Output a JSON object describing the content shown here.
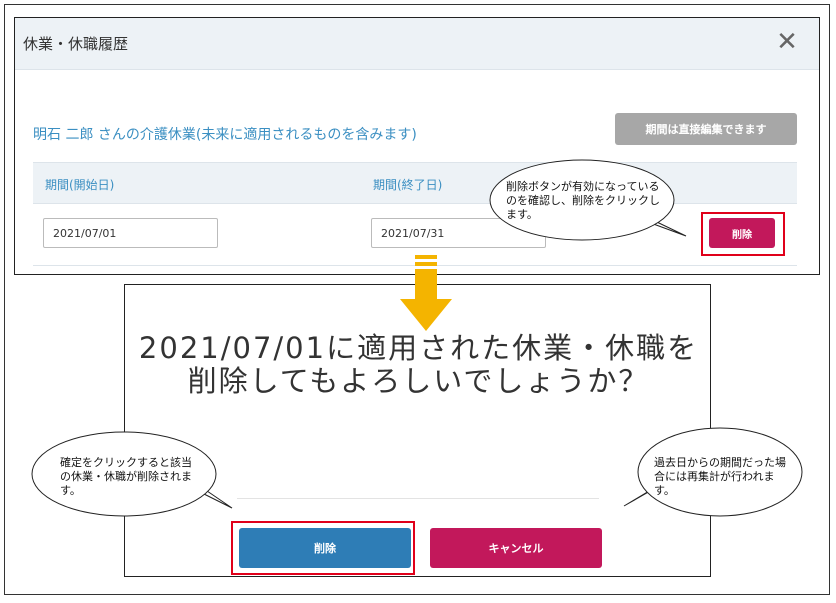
{
  "top_modal": {
    "title": "休業・休職履歴",
    "close_symbol": "✕",
    "employee_heading": "明石 二郎 さんの介護休業(未来に適用されるものを含みます)",
    "edit_direct_label": "期間は直接編集できます",
    "columns": {
      "start": "期間(開始日)",
      "end": "期間(終了日)"
    },
    "row": {
      "start_value": "2021/07/01",
      "end_value": "2021/07/31",
      "delete_label": "削除"
    }
  },
  "confirm_dialog": {
    "message": "2021/07/01に適用された休業・休職を削除してもよろしいでしょうか？",
    "delete_label": "削除",
    "cancel_label": "キャンセル"
  },
  "callouts": {
    "delete_check": "削除ボタンが有効になっているのを確認し、削除をクリックします。",
    "confirm_click": "確定をクリックすると該当の休業・休職が削除されます。",
    "recalc": "過去日からの期間だった場合には再集計が行われます。"
  },
  "colors": {
    "accent_blue": "#3b8fc2",
    "delete_magenta": "#c2185b",
    "confirm_blue": "#2e7db6",
    "highlight_red": "#e0001a",
    "arrow_yellow": "#f4b400",
    "disabled_gray": "#a7a7a7"
  },
  "icons": {
    "close": "close-icon",
    "arrow": "arrow-down-icon"
  }
}
